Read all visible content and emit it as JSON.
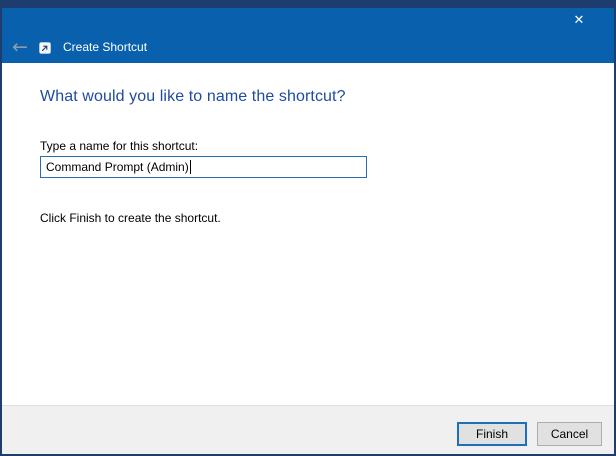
{
  "titlebar": {
    "close_icon": "✕"
  },
  "header": {
    "back_icon": "←",
    "wizard_icon": "shortcut-icon",
    "title": "Create Shortcut"
  },
  "main": {
    "heading": "What would you like to name the shortcut?",
    "input_label": "Type a name for this shortcut:",
    "input_value": "Command Prompt (Admin)",
    "instruction": "Click Finish to create the shortcut."
  },
  "footer": {
    "finish_label": "Finish",
    "cancel_label": "Cancel"
  },
  "colors": {
    "window_border": "#1e3c6e",
    "header_bg": "#0961ad",
    "heading_text": "#1f4ca0",
    "input_border": "#2a6cb4",
    "finish_focus_border": "#1d6fb7",
    "footer_bg": "#f0f0f0",
    "button_bg": "#e1e1e1"
  }
}
